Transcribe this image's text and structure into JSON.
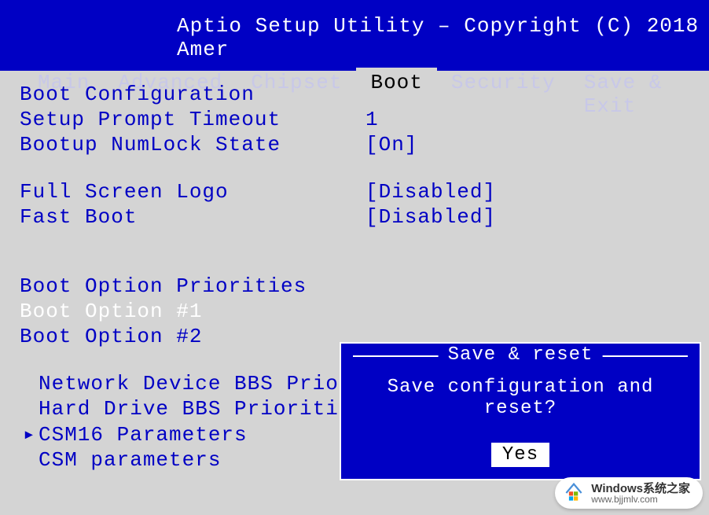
{
  "title": "Aptio Setup Utility – Copyright (C) 2018 Amer",
  "tabs": {
    "main": "Main",
    "advanced": "Advanced",
    "chipset": "Chipset",
    "boot": "Boot",
    "security": "Security",
    "save_exit": "Save & Exit"
  },
  "sections": {
    "boot_config": "Boot Configuration",
    "boot_priorities": "Boot Option Priorities"
  },
  "items": {
    "setup_prompt": {
      "label": "Setup Prompt Timeout",
      "value": "1"
    },
    "numlock": {
      "label": "Bootup NumLock State",
      "value": "[On]"
    },
    "full_screen_logo": {
      "label": "Full Screen Logo",
      "value": "[Disabled]"
    },
    "fast_boot": {
      "label": "Fast Boot",
      "value": "[Disabled]"
    },
    "boot_opt1": {
      "label": "Boot Option #1"
    },
    "boot_opt2": {
      "label": "Boot Option #2"
    }
  },
  "submenus": {
    "network_bbs": "Network Device BBS Priorities",
    "hard_drive_bbs": "Hard Drive BBS Priorities",
    "csm16": "CSM16 Parameters",
    "csm": "CSM parameters"
  },
  "dialog": {
    "title": "Save & reset",
    "message": "Save configuration and reset?",
    "yes": "Yes"
  },
  "watermark": {
    "main": "Windows系统之家",
    "sub": "www.bjjmlv.com"
  }
}
